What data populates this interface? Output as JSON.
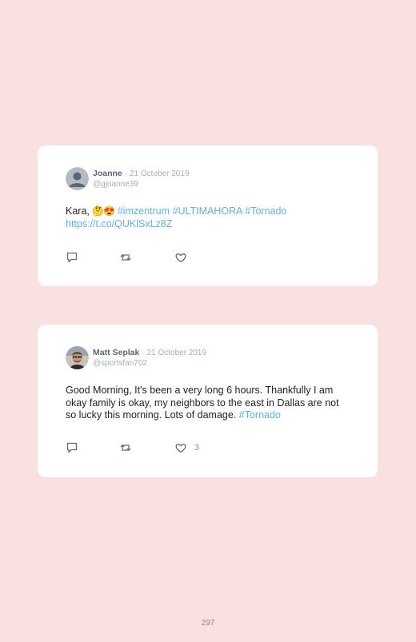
{
  "tweets": [
    {
      "name": "Joanne",
      "separator": "·",
      "date": "21 October 2019",
      "handle": "@gjoanne39",
      "text_prefix": "Kara, ",
      "emoji": "🤔😍",
      "hashtags": "#imzentrum #ULTIMAHORA #Tornado",
      "link": "https://t.co/QUKlSxLz8Z",
      "likes": "",
      "avatar_icon": "default-avatar-icon"
    },
    {
      "name": "Matt Seplak",
      "separator": "·",
      "date": "21 October 2019",
      "handle": "@sportsfan702",
      "text": "Good Morning, It's been a very long 6 hours. Thankfully I am okay family is okay, my neighbors to the east in Dallas are not so lucky this morning. Lots of damage. ",
      "hashtag": "#Tornado",
      "likes": "3",
      "avatar_icon": "user-photo-avatar"
    }
  ],
  "page_number": "297",
  "colors": {
    "background": "#fae1e1",
    "card": "#ffffff",
    "link": "#5cb3e6"
  }
}
